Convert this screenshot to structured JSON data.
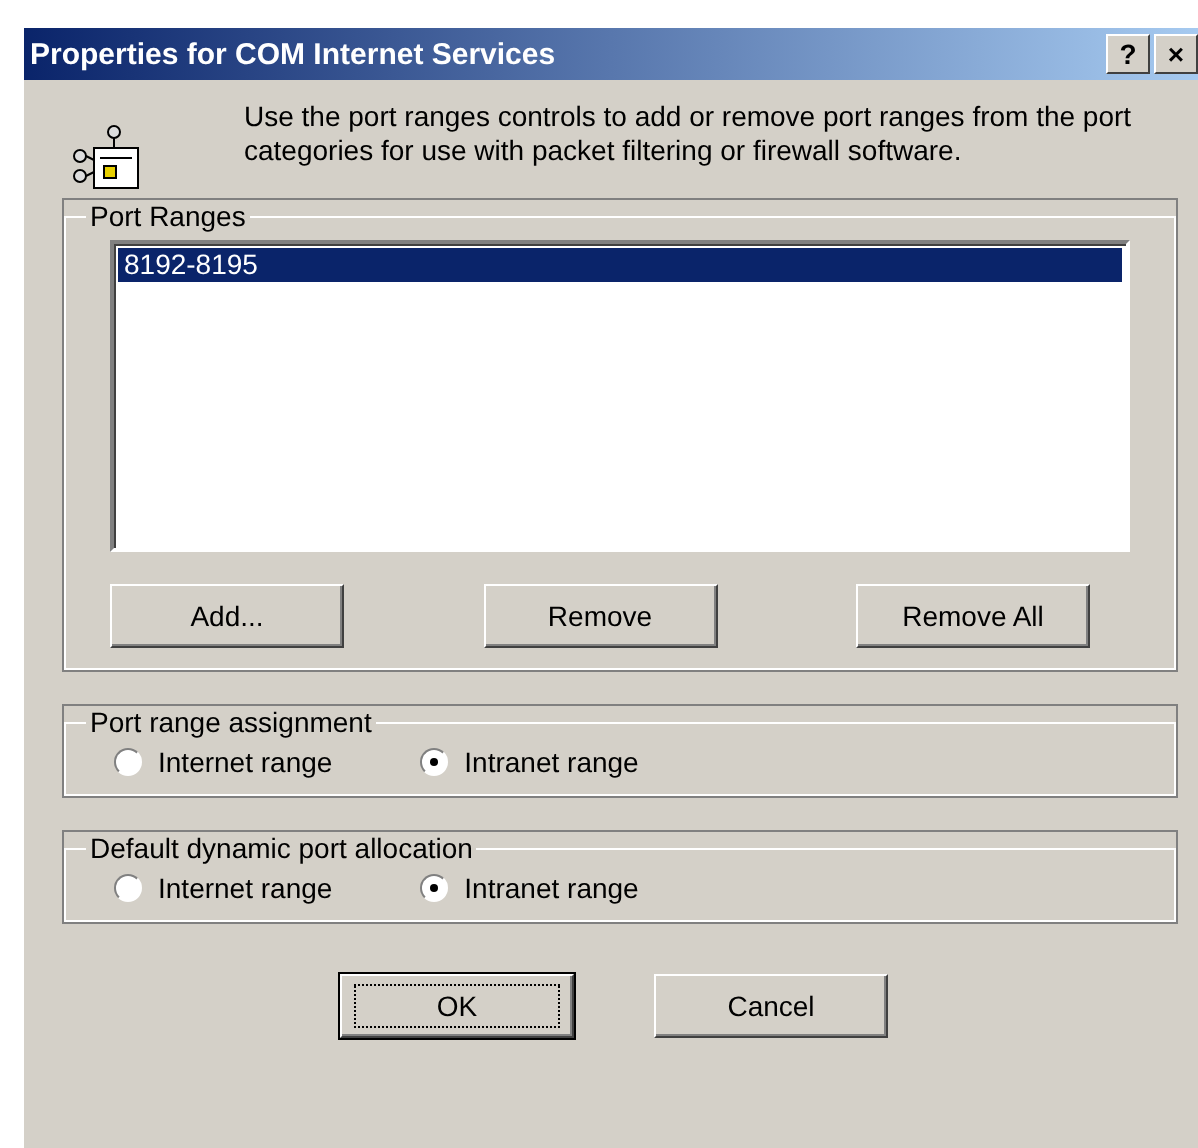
{
  "window": {
    "title": "Properties for COM Internet Services",
    "help_button": "?",
    "close_button": "×"
  },
  "description": "Use the port ranges controls to add or remove port ranges from the port categories for use with packet filtering or firewall software.",
  "port_ranges": {
    "label": "Port Ranges",
    "items": [
      {
        "text": "8192-8195",
        "selected": true
      }
    ],
    "buttons": [
      "Add...",
      "Remove",
      "Remove All"
    ]
  },
  "groups": [
    {
      "label": "Port range assignment",
      "options": [
        {
          "label": "Internet range",
          "selected": false
        },
        {
          "label": "Intranet range",
          "selected": true
        }
      ]
    },
    {
      "label": "Default dynamic port allocation",
      "options": [
        {
          "label": "Internet range",
          "selected": false
        },
        {
          "label": "Intranet range",
          "selected": true
        }
      ]
    }
  ],
  "buttons": [
    {
      "label": "OK",
      "default": true
    },
    {
      "label": "Cancel",
      "default": false
    }
  ]
}
